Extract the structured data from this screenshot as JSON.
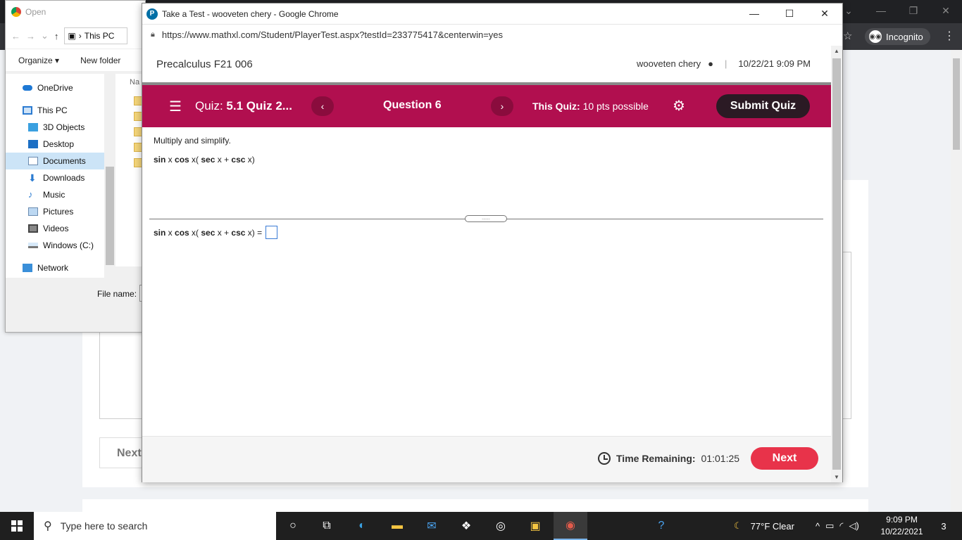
{
  "background_browser": {
    "incognito_label": "Incognito",
    "next_label": "Next"
  },
  "open_dialog": {
    "title": "Open",
    "address": "This PC",
    "organize": "Organize ▾",
    "new_folder": "New folder",
    "column_header": "Na",
    "nav_items": [
      {
        "label": "OneDrive"
      },
      {
        "label": "This PC"
      },
      {
        "label": "3D Objects"
      },
      {
        "label": "Desktop"
      },
      {
        "label": "Documents"
      },
      {
        "label": "Downloads"
      },
      {
        "label": "Music"
      },
      {
        "label": "Pictures"
      },
      {
        "label": "Videos"
      },
      {
        "label": "Windows (C:)"
      },
      {
        "label": "Network"
      }
    ],
    "file_name_label": "File name:"
  },
  "popup": {
    "title": "Take a Test - wooveten chery - Google Chrome",
    "url": "https://www.mathxl.com/Student/PlayerTest.aspx?testId=233775417&centerwin=yes",
    "course": "Precalculus F21 006",
    "user": "wooveten chery",
    "datetime": "10/22/21 9:09 PM",
    "quiz_label": "Quiz:",
    "quiz_name": "5.1 Quiz 2...",
    "question_label": "Question 6",
    "this_quiz_label": "This Quiz:",
    "points": "10 pts possible",
    "submit_label": "Submit Quiz",
    "instruction": "Multiply and simplify.",
    "expression": {
      "sin": "sin",
      "x1": " x ",
      "cos": "cos",
      "x2": " x( ",
      "sec": "sec",
      "x3": " x + ",
      "csc": "csc",
      "x4": " x)"
    },
    "answer_suffix": " =",
    "divider_handle": "......",
    "time_remaining_label": "Time Remaining:",
    "time_remaining_value": "01:01:25",
    "next_label": "Next"
  },
  "taskbar": {
    "search_placeholder": "Type here to search",
    "weather": "77°F  Clear",
    "time": "9:09 PM",
    "date": "10/22/2021",
    "notification_count": "3"
  },
  "colors": {
    "quiz_bar": "#b10f4f",
    "submit_button": "#2b1a24",
    "next_button": "#e8334a",
    "answer_box_border": "#3a7bd5"
  }
}
